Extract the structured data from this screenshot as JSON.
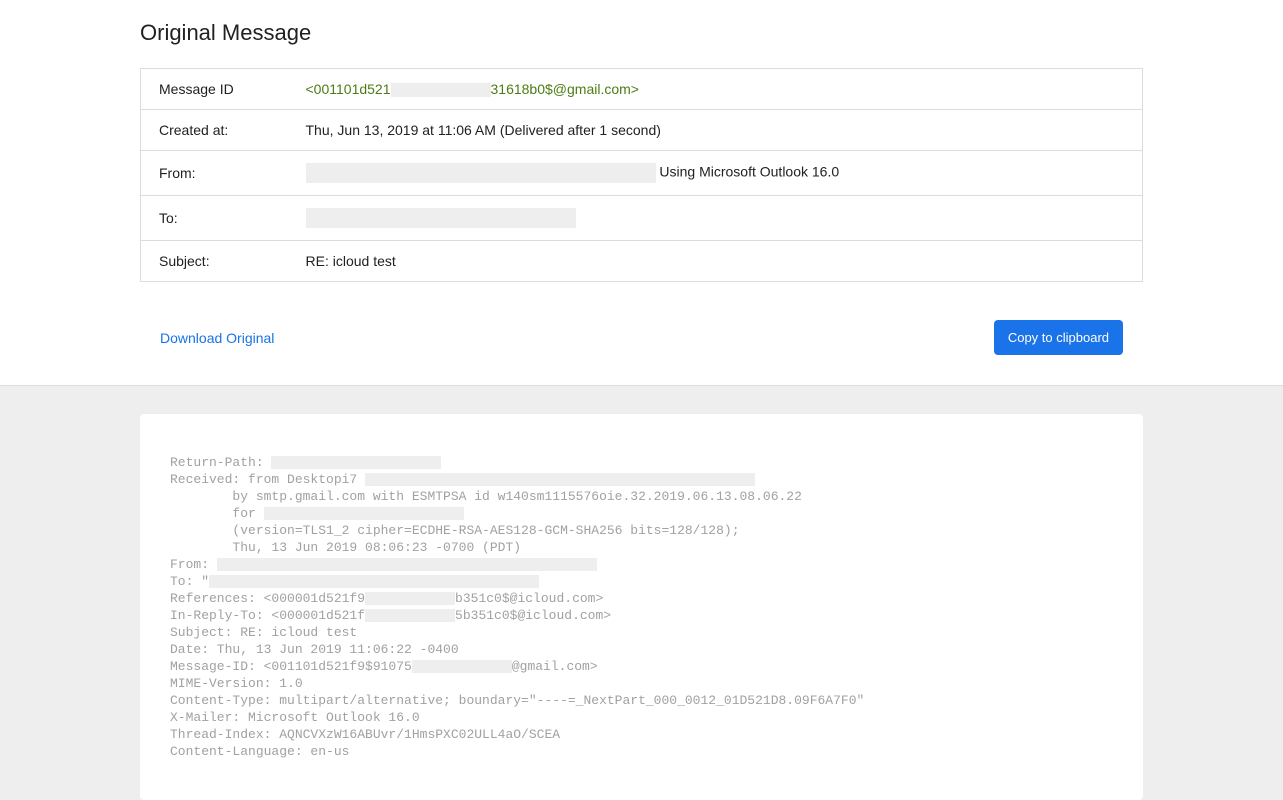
{
  "header": {
    "title": "Original Message",
    "metadata": {
      "message_id": {
        "label": "Message ID",
        "value_prefix": "<001101d521",
        "value_suffix": "31618b0$@gmail.com>"
      },
      "created_at": {
        "label": "Created at:",
        "value": "Thu, Jun 13, 2019 at 11:06 AM (Delivered after 1 second)"
      },
      "from": {
        "label": "From:",
        "suffix": " Using Microsoft Outlook 16.0"
      },
      "to": {
        "label": "To:"
      },
      "subject": {
        "label": "Subject:",
        "value": "RE: icloud test"
      }
    },
    "actions": {
      "download_label": "Download Original",
      "copy_label": "Copy to clipboard"
    }
  },
  "raw": {
    "lines": {
      "l0_prefix": "Return-Path: ",
      "l1_prefix": "Received: from Desktopi7 ",
      "l2": "        by smtp.gmail.com with ESMTPSA id w140sm1115576oie.32.2019.06.13.08.06.22",
      "l3_prefix": "        for ",
      "l4": "        (version=TLS1_2 cipher=ECDHE-RSA-AES128-GCM-SHA256 bits=128/128);",
      "l5": "        Thu, 13 Jun 2019 08:06:23 -0700 (PDT)",
      "l6_prefix": "From: ",
      "l7_prefix": "To: \"",
      "l8_prefix": "References: <000001d521f9",
      "l8_suffix": "b351c0$@icloud.com>",
      "l9_prefix": "In-Reply-To: <000001d521f",
      "l9_suffix": "5b351c0$@icloud.com>",
      "l10": "Subject: RE: icloud test",
      "l11": "Date: Thu, 13 Jun 2019 11:06:22 -0400",
      "l12_prefix": "Message-ID: <001101d521f9$91075",
      "l12_suffix": "@gmail.com>",
      "l13": "MIME-Version: 1.0",
      "l14": "Content-Type: multipart/alternative; boundary=\"----=_NextPart_000_0012_01D521D8.09F6A7F0\"",
      "l15": "X-Mailer: Microsoft Outlook 16.0",
      "l16": "Thread-Index: AQNCVXzW16ABUvr/1HmsPXC02ULL4aO/SCEA",
      "l17": "Content-Language: en-us"
    }
  }
}
